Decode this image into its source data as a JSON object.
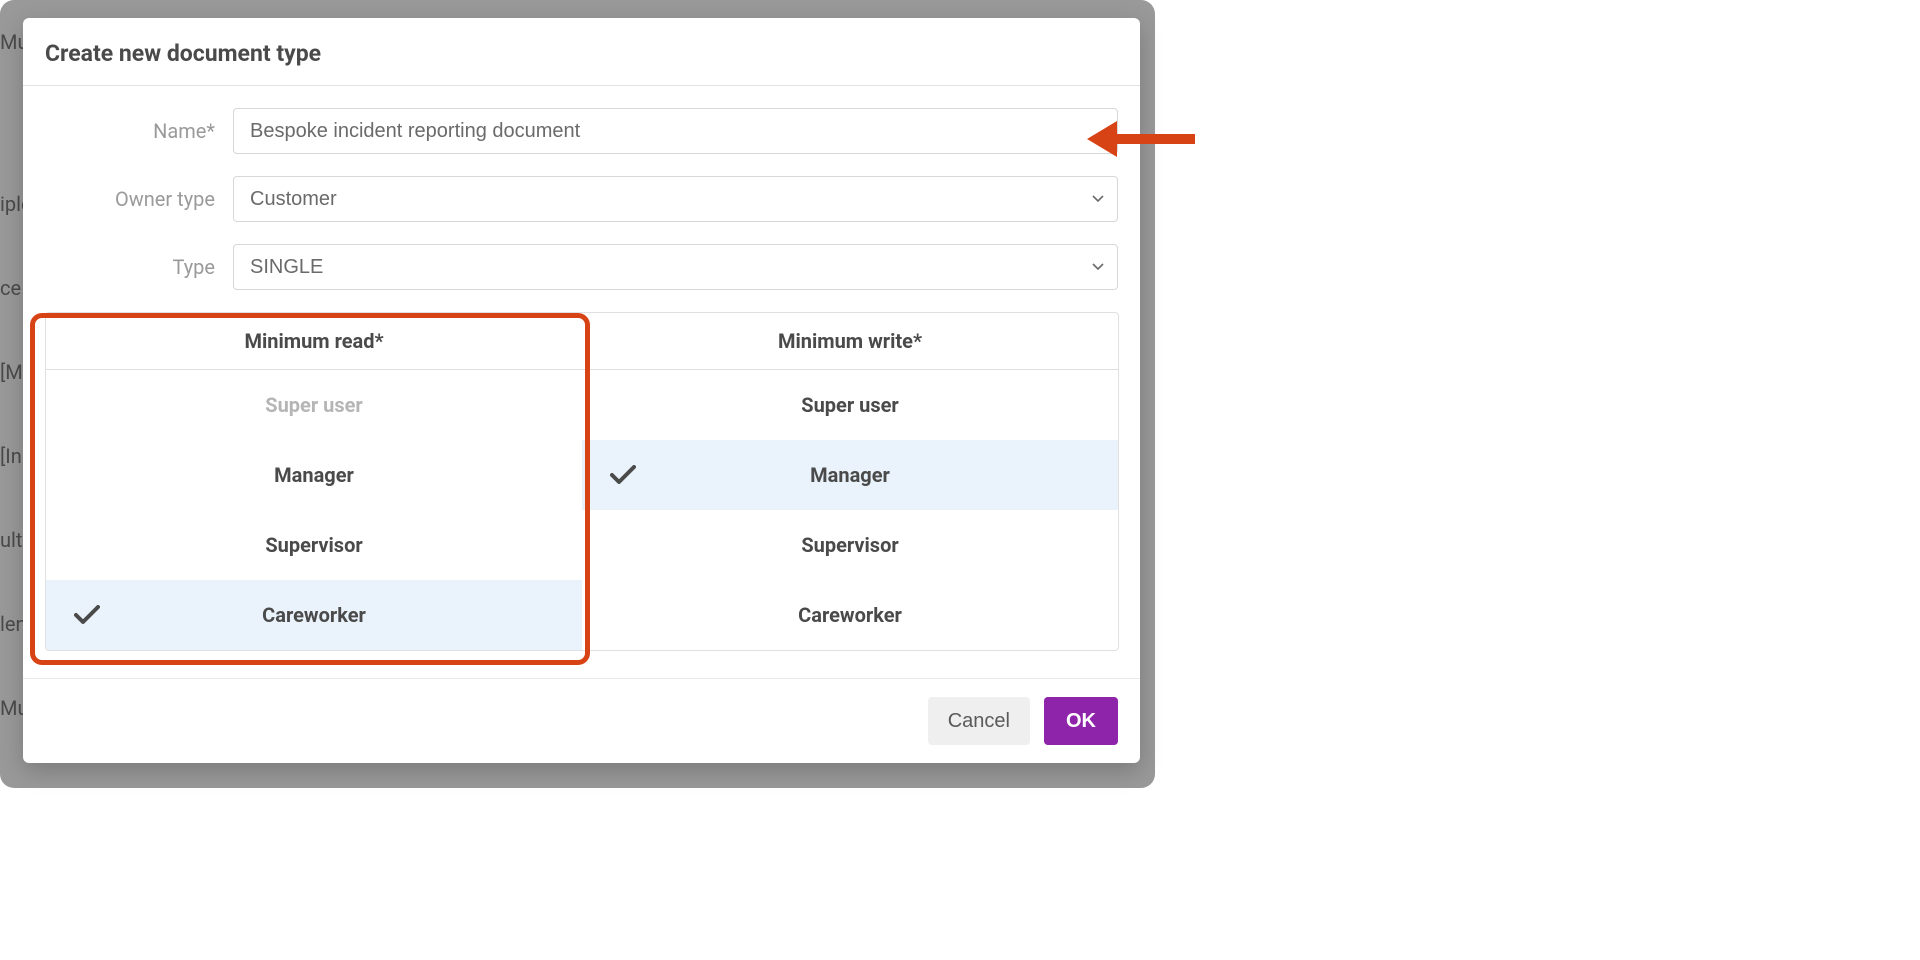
{
  "background_items": [
    "Mul",
    "iple",
    "ce",
    "[M",
    "[In",
    "ult",
    "len",
    "Mu"
  ],
  "modal": {
    "title": "Create new document type",
    "form": {
      "name_label": "Name*",
      "name_value": "Bespoke incident reporting document",
      "owner_type_label": "Owner type",
      "owner_type_value": "Customer",
      "type_label": "Type",
      "type_value": "SINGLE"
    },
    "permissions": {
      "read_header": "Minimum read*",
      "write_header": "Minimum write*",
      "roles": [
        "Super user",
        "Manager",
        "Supervisor",
        "Careworker"
      ],
      "read_selected_index": 3,
      "read_disabled_index": 0,
      "write_selected_index": 1
    },
    "footer": {
      "cancel_label": "Cancel",
      "ok_label": "OK"
    }
  }
}
